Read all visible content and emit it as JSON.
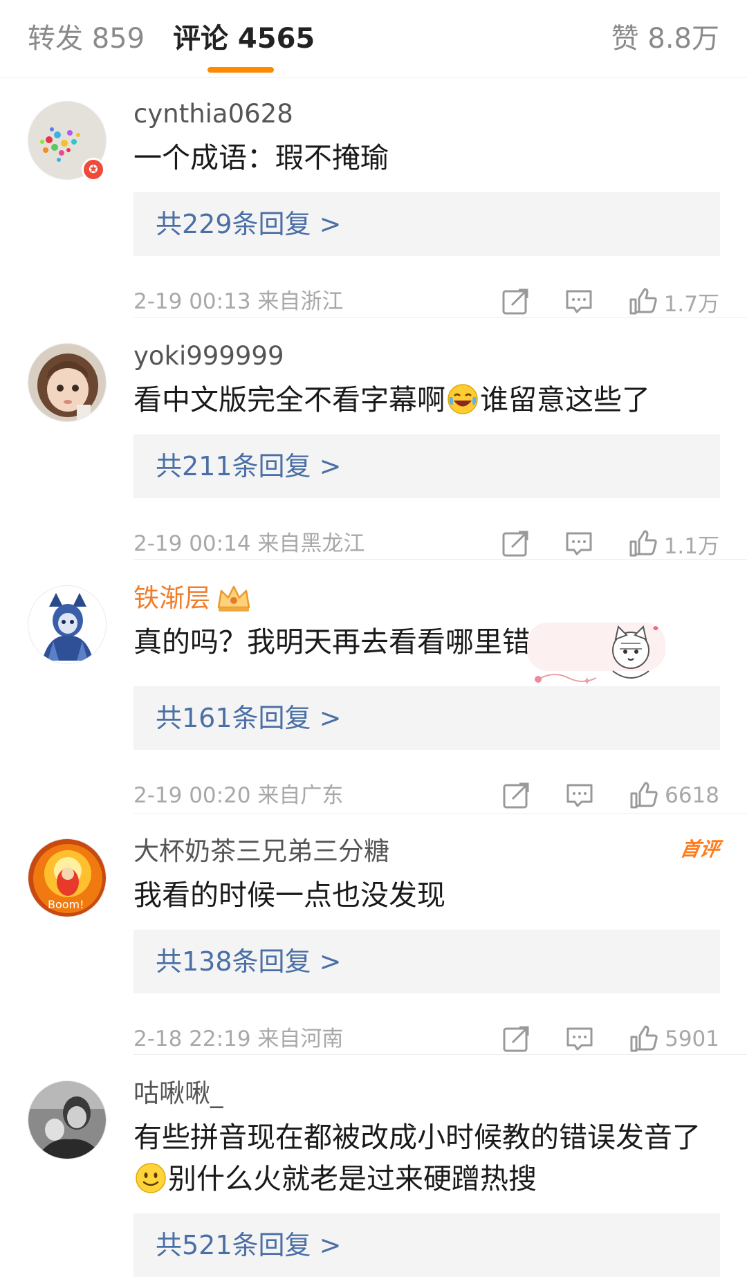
{
  "tabs": {
    "repost": "转发 859",
    "comment": "评论 4565",
    "like": "赞 8.8万",
    "accent_color": "#ff8a00"
  },
  "comments": [
    {
      "username": "cynthia0628",
      "text": "一个成语：瑕不掩瑜",
      "replies": "共229条回复 >",
      "meta": "2-19 00:13 来自浙江",
      "likes": "1.7万",
      "avatar_icon": "colorful-beads-avatar"
    },
    {
      "username": "yoki999999",
      "text_before": "看中文版完全不看字幕啊",
      "text_emoji": "laughing-crying-emoji",
      "text_after": "谁留意这些了",
      "replies": "共211条回复 >",
      "meta": "2-19 00:14 来自黑龙江",
      "likes": "1.1万",
      "avatar_icon": "doll-girl-avatar"
    },
    {
      "username": "铁渐层",
      "username_color": "#f07d2b",
      "text": "真的吗？我明天再去看看哪里错了",
      "replies": "共161条回复 >",
      "meta": "2-19 00:20 来自广东",
      "likes": "6618",
      "avatar_icon": "blue-character-avatar"
    },
    {
      "username": "大杯奶茶三兄弟三分糖",
      "badge": "首评",
      "text": "我看的时候一点也没发现",
      "replies": "共138条回复 >",
      "meta": "2-18 22:19 来自河南",
      "likes": "5901",
      "avatar_icon": "boom-teletubby-avatar"
    },
    {
      "username": "咕啾啾_",
      "text_before": "有些拼音现在都被改成小时候教的错误发音了",
      "text_emoji": "smile-emoji",
      "text_after": "别什么火就老是过来硬蹭热搜",
      "replies": "共521条回复 >",
      "avatar_icon": "bw-photo-avatar"
    }
  ]
}
